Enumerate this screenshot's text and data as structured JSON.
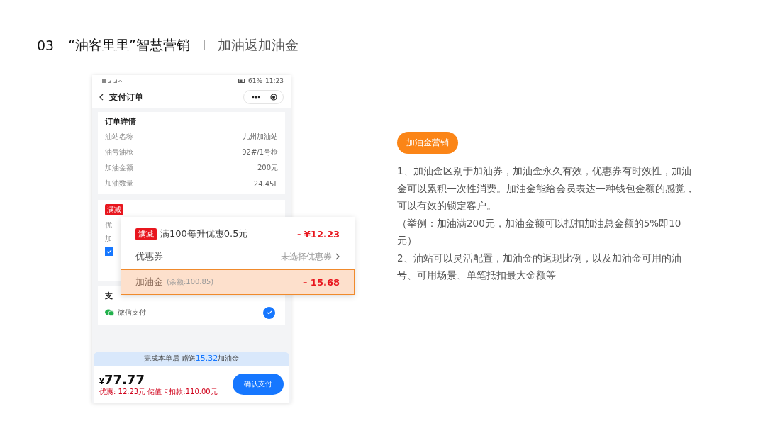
{
  "header": {
    "number": "03",
    "title": "“油客里里”智慧营销",
    "subtitle": "加油返加油金"
  },
  "phone": {
    "status_bar": {
      "battery": "61%",
      "time": "11:23"
    },
    "nav": {
      "title": "支付订单"
    },
    "order": {
      "title": "订单详情",
      "rows": [
        {
          "label": "油站名称",
          "value": "九州加油站"
        },
        {
          "label": "油号油枪",
          "value": "92#/1号枪"
        },
        {
          "label": "加油金额",
          "value": "200元"
        },
        {
          "label": "加油数量",
          "value": "24.45L"
        }
      ]
    },
    "discount_card": {
      "badge": "满减",
      "row_2_label": "优",
      "row_3_label": "加",
      "checked": true
    },
    "payment": {
      "title": "支",
      "method": "微信支付",
      "selected": true
    },
    "banner": {
      "prefix": "完成本单后 赠送",
      "amount": "15.32",
      "suffix": "加油金"
    },
    "total": {
      "currency": "¥",
      "amount": "77.77",
      "note": "优惠: 12.23元 储值卡扣款:110.00元"
    },
    "confirm_button": "确认支付"
  },
  "popup": {
    "rows": [
      {
        "kind": "promo",
        "badge": "满减",
        "label": "满100每升优惠0.5元",
        "value": "- ¥12.23",
        "highlighted": false
      },
      {
        "kind": "coupon",
        "label": "优惠券",
        "value": "未选择优惠券",
        "highlighted": false
      },
      {
        "kind": "fuel_gold",
        "label": "加油金",
        "note": "(余额:100.85)",
        "value": "- 15.68",
        "highlighted": true
      }
    ]
  },
  "explanation": {
    "tag": "加油金营销",
    "paragraphs": [
      "1、加油金区别于加油券，加油金永久有效，优惠券有时效性，加油金可以累积一次性消费。加油金能给会员表达一种钱包金额的感觉，可以有效的锁定客户。",
      "（举例：加油满200元，加油金额可以抵扣加油总金额的5%即10元）",
      "2、油站可以灵活配置，加油金的返现比例，以及加油金可用的油号、可用场景、单笔抵扣最大金额等"
    ]
  }
}
